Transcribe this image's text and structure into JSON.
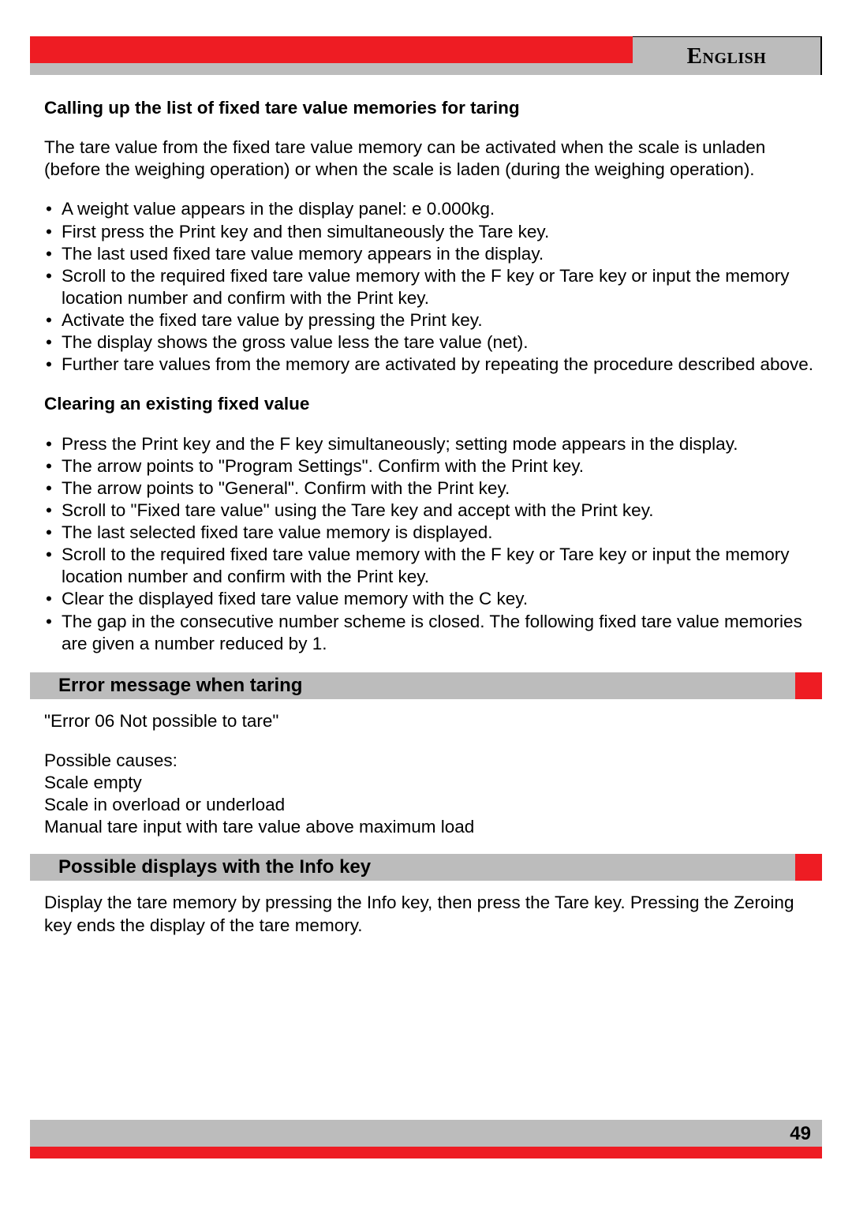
{
  "header": {
    "language": "English"
  },
  "section1": {
    "heading": "Calling up the list of fixed tare value memories for taring",
    "intro": "The tare value from the fixed tare value memory can be activated when the scale is unladen (before the weighing operation) or when the scale is laden (during the weighing operation).",
    "bullets": [
      "A weight value appears in the display panel: e 0.000kg.",
      "First press the Print key and then simultaneously the Tare key.",
      "The last used fixed tare value memory appears in the display.",
      "Scroll to the required fixed tare value memory with the F key or Tare key or input the memory location number and confirm with the Print key.",
      "Activate the fixed tare value by pressing the Print key.",
      "The display shows the gross value less the tare value (net).",
      "Further tare values from the memory are activated by repeating the procedure described above."
    ]
  },
  "section2": {
    "heading": "Clearing an existing fixed value",
    "bullets": [
      "Press the Print key and the F key simultaneously; setting mode appears in the display.",
      "The arrow points to \"Program Settings\". Confirm with the Print key.",
      "The arrow points to \"General\". Confirm with the Print key.",
      "Scroll to \"Fixed tare value\" using the Tare key and accept with the Print key.",
      "The last selected fixed tare value memory is displayed.",
      "Scroll to the required fixed tare value memory with the F key or Tare key or input the memory location number and confirm with the Print key.",
      "Clear the displayed fixed tare value memory with the C key.",
      "The gap in the consecutive number scheme is closed. The following fixed tare value memories are given a number reduced by 1."
    ]
  },
  "section3": {
    "title": "Error message when taring",
    "line1": "\"Error 06 Not possible to tare\"",
    "block": "Possible causes:\nScale empty\nScale in overload or underload\nManual tare input with tare value above maximum load"
  },
  "section4": {
    "title": "Possible displays with the Info key",
    "para": "Display the tare memory by pressing the Info key, then press the Tare key. Pressing the Zeroing key ends the display of the tare memory."
  },
  "footer": {
    "page": "49"
  }
}
